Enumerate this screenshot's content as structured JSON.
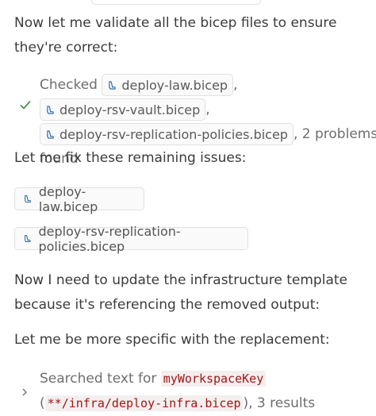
{
  "messages": {
    "validate_intro": "Now let me validate all the bicep files to ensure they're correct:",
    "fix_intro": "Let me fix these remaining issues:",
    "update_intro": "Now I need to update the infrastructure template because it's referencing the removed output:",
    "specific_intro": "Let me be more specific with the replacement:"
  },
  "check_result": {
    "prefix": "Checked",
    "files": [
      "deploy-law.bicep",
      "deploy-rsv-vault.bicep",
      "deploy-rsv-replication-policies.bicep"
    ],
    "separator": ",",
    "suffix": ", 2 problems found",
    "icon": "check-icon",
    "status_color": "#388a34"
  },
  "edited_files": [
    "deploy-law.bicep",
    "deploy-rsv-replication-policies.bicep"
  ],
  "search_result": {
    "prefix": "Searched text for",
    "term": "myWorkspaceKey",
    "open_paren": "(",
    "path": "**/infra/deploy-infra.bicep",
    "suffix": "), 3 results",
    "icon": "chevron-right-icon"
  },
  "colors": {
    "text": "#3b3b3b",
    "muted": "#6e6e6e",
    "code_text": "#a31515",
    "code_bg": "#f3efef",
    "chip_border": "#e0e0e0",
    "bicep_icon": "#2f6ea8"
  }
}
